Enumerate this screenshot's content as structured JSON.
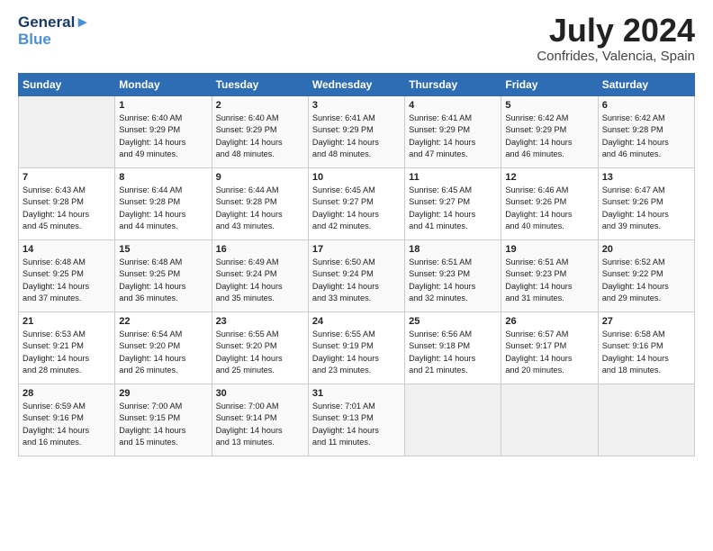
{
  "header": {
    "logo_line1": "General",
    "logo_line2": "Blue",
    "month": "July 2024",
    "location": "Confrides, Valencia, Spain"
  },
  "weekdays": [
    "Sunday",
    "Monday",
    "Tuesday",
    "Wednesday",
    "Thursday",
    "Friday",
    "Saturday"
  ],
  "weeks": [
    [
      {
        "num": "",
        "info": ""
      },
      {
        "num": "1",
        "info": "Sunrise: 6:40 AM\nSunset: 9:29 PM\nDaylight: 14 hours\nand 49 minutes."
      },
      {
        "num": "2",
        "info": "Sunrise: 6:40 AM\nSunset: 9:29 PM\nDaylight: 14 hours\nand 48 minutes."
      },
      {
        "num": "3",
        "info": "Sunrise: 6:41 AM\nSunset: 9:29 PM\nDaylight: 14 hours\nand 48 minutes."
      },
      {
        "num": "4",
        "info": "Sunrise: 6:41 AM\nSunset: 9:29 PM\nDaylight: 14 hours\nand 47 minutes."
      },
      {
        "num": "5",
        "info": "Sunrise: 6:42 AM\nSunset: 9:29 PM\nDaylight: 14 hours\nand 46 minutes."
      },
      {
        "num": "6",
        "info": "Sunrise: 6:42 AM\nSunset: 9:28 PM\nDaylight: 14 hours\nand 46 minutes."
      }
    ],
    [
      {
        "num": "7",
        "info": "Sunrise: 6:43 AM\nSunset: 9:28 PM\nDaylight: 14 hours\nand 45 minutes."
      },
      {
        "num": "8",
        "info": "Sunrise: 6:44 AM\nSunset: 9:28 PM\nDaylight: 14 hours\nand 44 minutes."
      },
      {
        "num": "9",
        "info": "Sunrise: 6:44 AM\nSunset: 9:28 PM\nDaylight: 14 hours\nand 43 minutes."
      },
      {
        "num": "10",
        "info": "Sunrise: 6:45 AM\nSunset: 9:27 PM\nDaylight: 14 hours\nand 42 minutes."
      },
      {
        "num": "11",
        "info": "Sunrise: 6:45 AM\nSunset: 9:27 PM\nDaylight: 14 hours\nand 41 minutes."
      },
      {
        "num": "12",
        "info": "Sunrise: 6:46 AM\nSunset: 9:26 PM\nDaylight: 14 hours\nand 40 minutes."
      },
      {
        "num": "13",
        "info": "Sunrise: 6:47 AM\nSunset: 9:26 PM\nDaylight: 14 hours\nand 39 minutes."
      }
    ],
    [
      {
        "num": "14",
        "info": "Sunrise: 6:48 AM\nSunset: 9:25 PM\nDaylight: 14 hours\nand 37 minutes."
      },
      {
        "num": "15",
        "info": "Sunrise: 6:48 AM\nSunset: 9:25 PM\nDaylight: 14 hours\nand 36 minutes."
      },
      {
        "num": "16",
        "info": "Sunrise: 6:49 AM\nSunset: 9:24 PM\nDaylight: 14 hours\nand 35 minutes."
      },
      {
        "num": "17",
        "info": "Sunrise: 6:50 AM\nSunset: 9:24 PM\nDaylight: 14 hours\nand 33 minutes."
      },
      {
        "num": "18",
        "info": "Sunrise: 6:51 AM\nSunset: 9:23 PM\nDaylight: 14 hours\nand 32 minutes."
      },
      {
        "num": "19",
        "info": "Sunrise: 6:51 AM\nSunset: 9:23 PM\nDaylight: 14 hours\nand 31 minutes."
      },
      {
        "num": "20",
        "info": "Sunrise: 6:52 AM\nSunset: 9:22 PM\nDaylight: 14 hours\nand 29 minutes."
      }
    ],
    [
      {
        "num": "21",
        "info": "Sunrise: 6:53 AM\nSunset: 9:21 PM\nDaylight: 14 hours\nand 28 minutes."
      },
      {
        "num": "22",
        "info": "Sunrise: 6:54 AM\nSunset: 9:20 PM\nDaylight: 14 hours\nand 26 minutes."
      },
      {
        "num": "23",
        "info": "Sunrise: 6:55 AM\nSunset: 9:20 PM\nDaylight: 14 hours\nand 25 minutes."
      },
      {
        "num": "24",
        "info": "Sunrise: 6:55 AM\nSunset: 9:19 PM\nDaylight: 14 hours\nand 23 minutes."
      },
      {
        "num": "25",
        "info": "Sunrise: 6:56 AM\nSunset: 9:18 PM\nDaylight: 14 hours\nand 21 minutes."
      },
      {
        "num": "26",
        "info": "Sunrise: 6:57 AM\nSunset: 9:17 PM\nDaylight: 14 hours\nand 20 minutes."
      },
      {
        "num": "27",
        "info": "Sunrise: 6:58 AM\nSunset: 9:16 PM\nDaylight: 14 hours\nand 18 minutes."
      }
    ],
    [
      {
        "num": "28",
        "info": "Sunrise: 6:59 AM\nSunset: 9:16 PM\nDaylight: 14 hours\nand 16 minutes."
      },
      {
        "num": "29",
        "info": "Sunrise: 7:00 AM\nSunset: 9:15 PM\nDaylight: 14 hours\nand 15 minutes."
      },
      {
        "num": "30",
        "info": "Sunrise: 7:00 AM\nSunset: 9:14 PM\nDaylight: 14 hours\nand 13 minutes."
      },
      {
        "num": "31",
        "info": "Sunrise: 7:01 AM\nSunset: 9:13 PM\nDaylight: 14 hours\nand 11 minutes."
      },
      {
        "num": "",
        "info": ""
      },
      {
        "num": "",
        "info": ""
      },
      {
        "num": "",
        "info": ""
      }
    ]
  ]
}
